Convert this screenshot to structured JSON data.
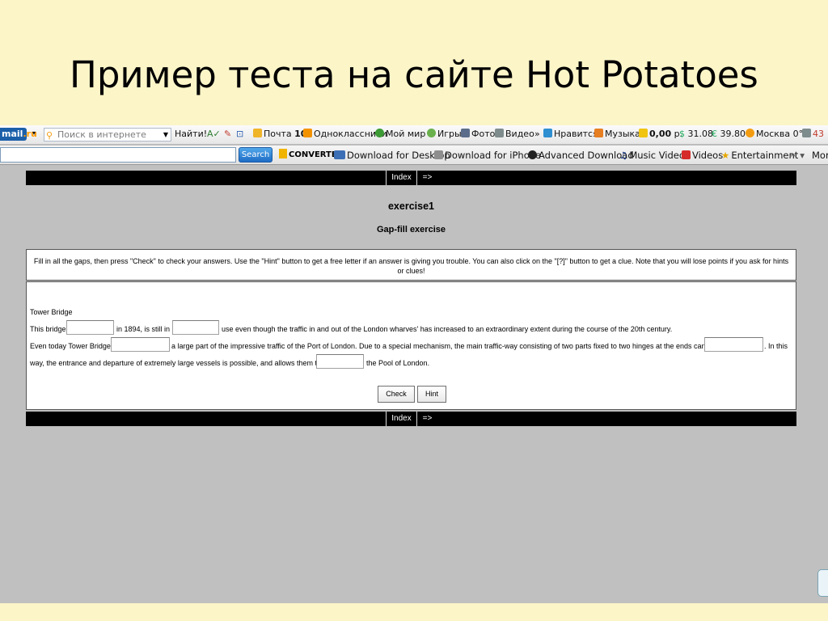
{
  "slide": {
    "title": "Пример теста на сайте Hot Potatoes"
  },
  "toolbar1": {
    "logo_main": "mail",
    "logo_ru": ".ru",
    "search_placeholder": "Поиск в интернете",
    "find_button": "Найти!",
    "items": [
      {
        "label": "Почта",
        "count": "10"
      },
      {
        "label": "Одноклассники"
      },
      {
        "label": "Мой мир"
      },
      {
        "label": "Игры"
      },
      {
        "label": "Фото"
      },
      {
        "label": "Видео"
      },
      {
        "label": "Нравится"
      },
      {
        "label": "Музыка"
      },
      {
        "label": "0,00",
        "unit": "р."
      },
      {
        "label": "31.08"
      },
      {
        "label": "39.80"
      },
      {
        "label": "Москва 0°C"
      },
      {
        "label": "43"
      }
    ],
    "more_glyph": "»"
  },
  "toolbar2": {
    "search_button": "Search",
    "vdc_label": "CONVERTER",
    "links": [
      {
        "label": "Download for Desktop"
      },
      {
        "label": "Download for iPhone"
      },
      {
        "label": "Advanced Download"
      },
      {
        "label": "Music Videos"
      },
      {
        "label": "Videos"
      },
      {
        "label": "Entertainment"
      },
      {
        "label": "Mor"
      }
    ]
  },
  "exercise": {
    "nav_index": "Index",
    "nav_next": "=>",
    "title": "exercise1",
    "subtitle": "Gap-fill exercise",
    "instructions": "Fill in all the gaps, then press \"Check\" to check your answers. Use the \"Hint\" button to get a free letter if an answer is giving you trouble. You can also click on the \"[?]\" button to get a clue. Note that you will lose points if you ask for hints or clues!",
    "text": {
      "heading": "Tower Bridge",
      "l1a": "This bridge",
      "l1b": "in 1894, is still in",
      "l1c": "use even though the traffic in and out of the London wharves' has increased to an extraordinary extent during the course of the 20th century.",
      "l2a": "Even today Tower Bridge",
      "l2b": "a large part of the impressive traffic of the Port of London. Due to a special mechanism, the main traffic-way consisting of two parts fixed to two hinges at the ends can be",
      "l2c": ". In this",
      "l3a": "way, the entrance and departure of extremely large vessels is possible, and allows them to",
      "l3b": "the Pool of London."
    },
    "check_button": "Check",
    "hint_button": "Hint"
  }
}
